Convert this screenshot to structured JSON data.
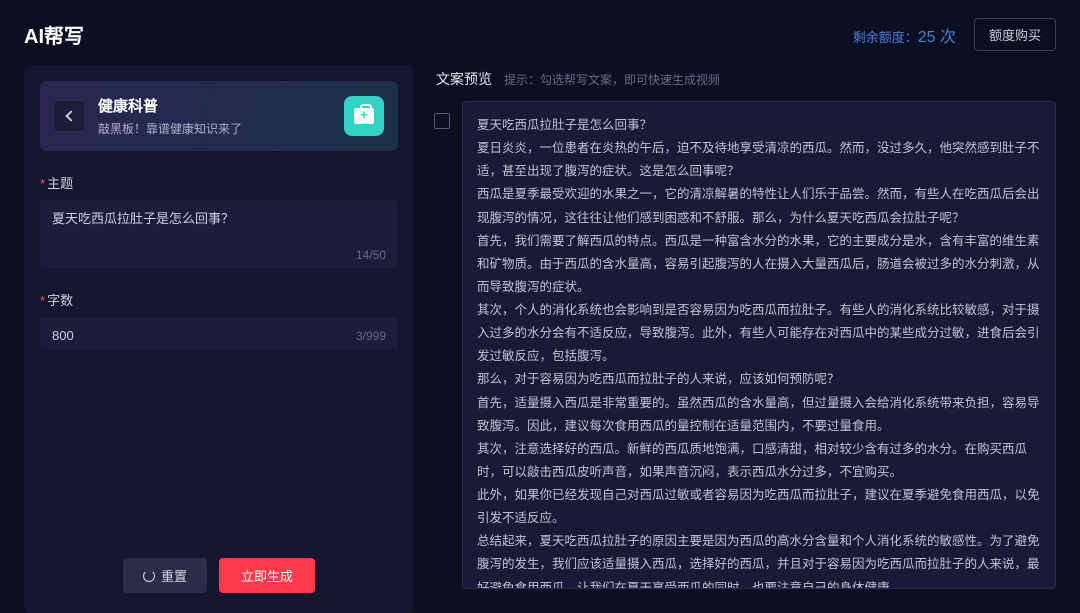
{
  "header": {
    "title": "AI帮写",
    "credit_label": "剩余额度：",
    "credit_value": "25 次",
    "buy_label": "额度购买"
  },
  "category": {
    "title": "健康科普",
    "subtitle": "敲黑板！靠谱健康知识来了"
  },
  "form": {
    "topic_label": "主题",
    "topic_value": "夏天吃西瓜拉肚子是怎么回事？",
    "topic_counter": "14/50",
    "words_label": "字数",
    "words_value": "800",
    "words_counter": "3/999"
  },
  "buttons": {
    "reset": "重置",
    "generate": "立即生成"
  },
  "preview": {
    "title": "文案预览",
    "hint": "提示：勾选帮写文案，即可快速生成视频",
    "paragraphs": [
      "夏天吃西瓜拉肚子是怎么回事？",
      "夏日炎炎，一位患者在炎热的午后，迫不及待地享受清凉的西瓜。然而，没过多久，他突然感到肚子不适，甚至出现了腹泻的症状。这是怎么回事呢？",
      "西瓜是夏季最受欢迎的水果之一，它的清凉解暑的特性让人们乐于品尝。然而，有些人在吃西瓜后会出现腹泻的情况，这往往让他们感到困惑和不舒服。那么，为什么夏天吃西瓜会拉肚子呢？",
      "首先，我们需要了解西瓜的特点。西瓜是一种富含水分的水果，它的主要成分是水，含有丰富的维生素和矿物质。由于西瓜的含水量高，容易引起腹泻的人在摄入大量西瓜后，肠道会被过多的水分刺激，从而导致腹泻的症状。",
      "其次，个人的消化系统也会影响到是否容易因为吃西瓜而拉肚子。有些人的消化系统比较敏感，对于摄入过多的水分会有不适反应，导致腹泻。此外，有些人可能存在对西瓜中的某些成分过敏，进食后会引发过敏反应，包括腹泻。",
      "那么，对于容易因为吃西瓜而拉肚子的人来说，应该如何预防呢？",
      "首先，适量摄入西瓜是非常重要的。虽然西瓜的含水量高，但过量摄入会给消化系统带来负担，容易导致腹泻。因此，建议每次食用西瓜的量控制在适量范围内，不要过量食用。",
      "其次，注意选择好的西瓜。新鲜的西瓜质地饱满，口感清甜，相对较少含有过多的水分。在购买西瓜时，可以敲击西瓜皮听声音，如果声音沉闷，表示西瓜水分过多，不宜购买。",
      "此外，如果你已经发现自己对西瓜过敏或者容易因为吃西瓜而拉肚子，建议在夏季避免食用西瓜，以免引发不适反应。",
      "总结起来，夏天吃西瓜拉肚子的原因主要是因为西瓜的高水分含量和个人消化系统的敏感性。为了避免腹泻的发生，我们应该适量摄入西瓜，选择好的西瓜，并且对于容易因为吃西瓜而拉肚子的人来说，最好避免食用西瓜。让我们在夏天享受西瓜的同时，也要注意自己的身体健康。"
    ]
  }
}
